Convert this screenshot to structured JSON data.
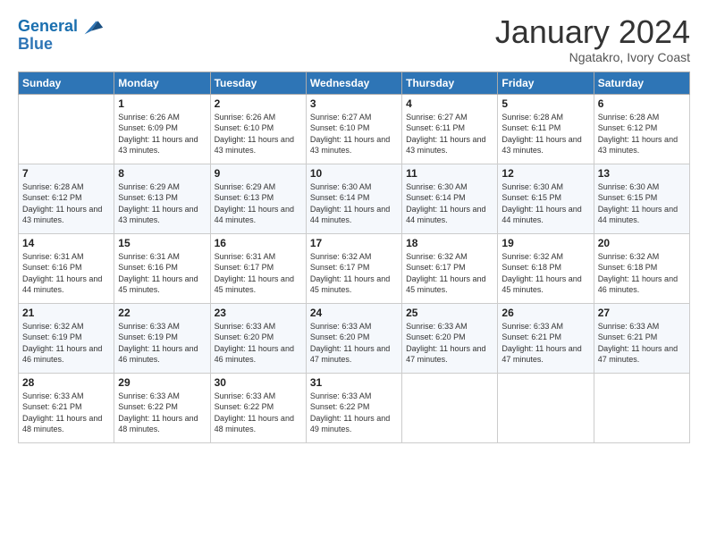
{
  "header": {
    "logo_line1": "General",
    "logo_line2": "Blue",
    "month_title": "January 2024",
    "location": "Ngatakro, Ivory Coast"
  },
  "weekdays": [
    "Sunday",
    "Monday",
    "Tuesday",
    "Wednesday",
    "Thursday",
    "Friday",
    "Saturday"
  ],
  "weeks": [
    [
      {
        "num": "",
        "sunrise": "",
        "sunset": "",
        "daylight": ""
      },
      {
        "num": "1",
        "sunrise": "Sunrise: 6:26 AM",
        "sunset": "Sunset: 6:09 PM",
        "daylight": "Daylight: 11 hours and 43 minutes."
      },
      {
        "num": "2",
        "sunrise": "Sunrise: 6:26 AM",
        "sunset": "Sunset: 6:10 PM",
        "daylight": "Daylight: 11 hours and 43 minutes."
      },
      {
        "num": "3",
        "sunrise": "Sunrise: 6:27 AM",
        "sunset": "Sunset: 6:10 PM",
        "daylight": "Daylight: 11 hours and 43 minutes."
      },
      {
        "num": "4",
        "sunrise": "Sunrise: 6:27 AM",
        "sunset": "Sunset: 6:11 PM",
        "daylight": "Daylight: 11 hours and 43 minutes."
      },
      {
        "num": "5",
        "sunrise": "Sunrise: 6:28 AM",
        "sunset": "Sunset: 6:11 PM",
        "daylight": "Daylight: 11 hours and 43 minutes."
      },
      {
        "num": "6",
        "sunrise": "Sunrise: 6:28 AM",
        "sunset": "Sunset: 6:12 PM",
        "daylight": "Daylight: 11 hours and 43 minutes."
      }
    ],
    [
      {
        "num": "7",
        "sunrise": "Sunrise: 6:28 AM",
        "sunset": "Sunset: 6:12 PM",
        "daylight": "Daylight: 11 hours and 43 minutes."
      },
      {
        "num": "8",
        "sunrise": "Sunrise: 6:29 AM",
        "sunset": "Sunset: 6:13 PM",
        "daylight": "Daylight: 11 hours and 43 minutes."
      },
      {
        "num": "9",
        "sunrise": "Sunrise: 6:29 AM",
        "sunset": "Sunset: 6:13 PM",
        "daylight": "Daylight: 11 hours and 44 minutes."
      },
      {
        "num": "10",
        "sunrise": "Sunrise: 6:30 AM",
        "sunset": "Sunset: 6:14 PM",
        "daylight": "Daylight: 11 hours and 44 minutes."
      },
      {
        "num": "11",
        "sunrise": "Sunrise: 6:30 AM",
        "sunset": "Sunset: 6:14 PM",
        "daylight": "Daylight: 11 hours and 44 minutes."
      },
      {
        "num": "12",
        "sunrise": "Sunrise: 6:30 AM",
        "sunset": "Sunset: 6:15 PM",
        "daylight": "Daylight: 11 hours and 44 minutes."
      },
      {
        "num": "13",
        "sunrise": "Sunrise: 6:30 AM",
        "sunset": "Sunset: 6:15 PM",
        "daylight": "Daylight: 11 hours and 44 minutes."
      }
    ],
    [
      {
        "num": "14",
        "sunrise": "Sunrise: 6:31 AM",
        "sunset": "Sunset: 6:16 PM",
        "daylight": "Daylight: 11 hours and 44 minutes."
      },
      {
        "num": "15",
        "sunrise": "Sunrise: 6:31 AM",
        "sunset": "Sunset: 6:16 PM",
        "daylight": "Daylight: 11 hours and 45 minutes."
      },
      {
        "num": "16",
        "sunrise": "Sunrise: 6:31 AM",
        "sunset": "Sunset: 6:17 PM",
        "daylight": "Daylight: 11 hours and 45 minutes."
      },
      {
        "num": "17",
        "sunrise": "Sunrise: 6:32 AM",
        "sunset": "Sunset: 6:17 PM",
        "daylight": "Daylight: 11 hours and 45 minutes."
      },
      {
        "num": "18",
        "sunrise": "Sunrise: 6:32 AM",
        "sunset": "Sunset: 6:17 PM",
        "daylight": "Daylight: 11 hours and 45 minutes."
      },
      {
        "num": "19",
        "sunrise": "Sunrise: 6:32 AM",
        "sunset": "Sunset: 6:18 PM",
        "daylight": "Daylight: 11 hours and 45 minutes."
      },
      {
        "num": "20",
        "sunrise": "Sunrise: 6:32 AM",
        "sunset": "Sunset: 6:18 PM",
        "daylight": "Daylight: 11 hours and 46 minutes."
      }
    ],
    [
      {
        "num": "21",
        "sunrise": "Sunrise: 6:32 AM",
        "sunset": "Sunset: 6:19 PM",
        "daylight": "Daylight: 11 hours and 46 minutes."
      },
      {
        "num": "22",
        "sunrise": "Sunrise: 6:33 AM",
        "sunset": "Sunset: 6:19 PM",
        "daylight": "Daylight: 11 hours and 46 minutes."
      },
      {
        "num": "23",
        "sunrise": "Sunrise: 6:33 AM",
        "sunset": "Sunset: 6:20 PM",
        "daylight": "Daylight: 11 hours and 46 minutes."
      },
      {
        "num": "24",
        "sunrise": "Sunrise: 6:33 AM",
        "sunset": "Sunset: 6:20 PM",
        "daylight": "Daylight: 11 hours and 47 minutes."
      },
      {
        "num": "25",
        "sunrise": "Sunrise: 6:33 AM",
        "sunset": "Sunset: 6:20 PM",
        "daylight": "Daylight: 11 hours and 47 minutes."
      },
      {
        "num": "26",
        "sunrise": "Sunrise: 6:33 AM",
        "sunset": "Sunset: 6:21 PM",
        "daylight": "Daylight: 11 hours and 47 minutes."
      },
      {
        "num": "27",
        "sunrise": "Sunrise: 6:33 AM",
        "sunset": "Sunset: 6:21 PM",
        "daylight": "Daylight: 11 hours and 47 minutes."
      }
    ],
    [
      {
        "num": "28",
        "sunrise": "Sunrise: 6:33 AM",
        "sunset": "Sunset: 6:21 PM",
        "daylight": "Daylight: 11 hours and 48 minutes."
      },
      {
        "num": "29",
        "sunrise": "Sunrise: 6:33 AM",
        "sunset": "Sunset: 6:22 PM",
        "daylight": "Daylight: 11 hours and 48 minutes."
      },
      {
        "num": "30",
        "sunrise": "Sunrise: 6:33 AM",
        "sunset": "Sunset: 6:22 PM",
        "daylight": "Daylight: 11 hours and 48 minutes."
      },
      {
        "num": "31",
        "sunrise": "Sunrise: 6:33 AM",
        "sunset": "Sunset: 6:22 PM",
        "daylight": "Daylight: 11 hours and 49 minutes."
      },
      {
        "num": "",
        "sunrise": "",
        "sunset": "",
        "daylight": ""
      },
      {
        "num": "",
        "sunrise": "",
        "sunset": "",
        "daylight": ""
      },
      {
        "num": "",
        "sunrise": "",
        "sunset": "",
        "daylight": ""
      }
    ]
  ]
}
